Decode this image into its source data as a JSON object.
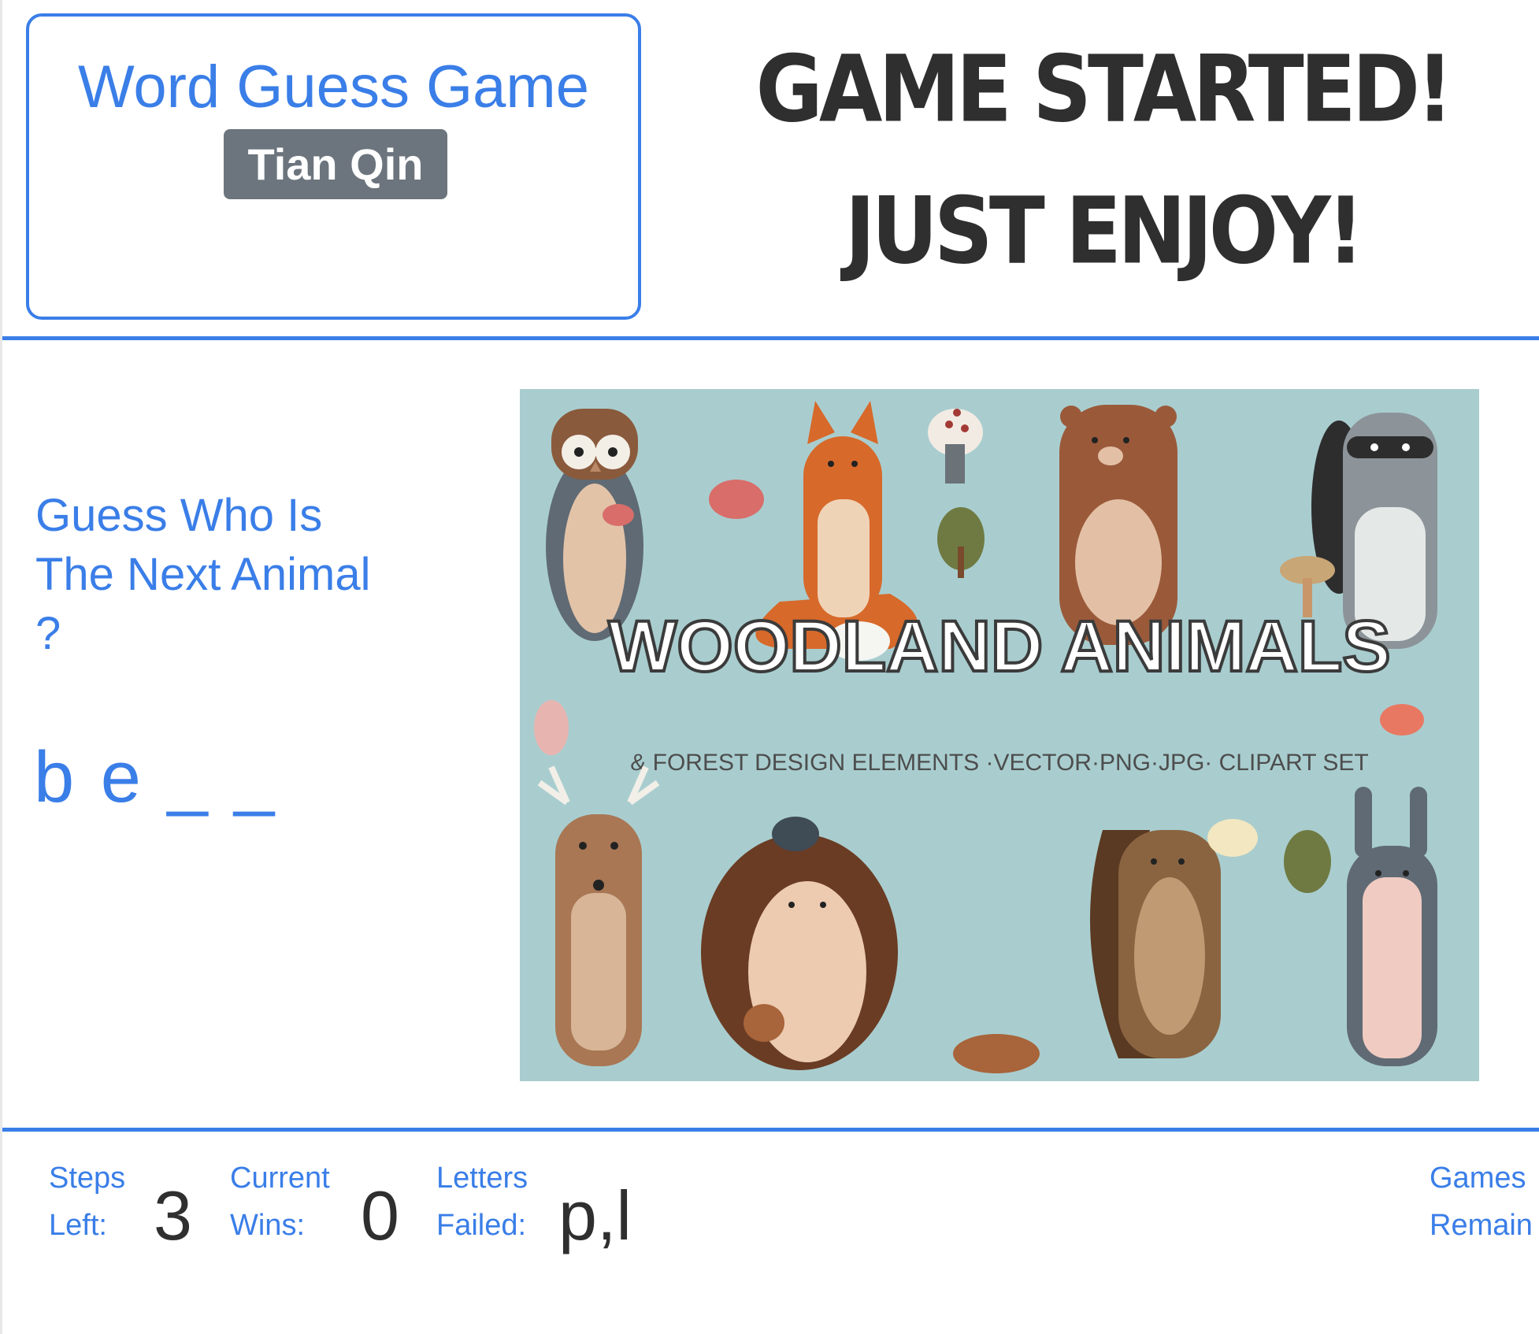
{
  "header": {
    "title": "Word Guess Game",
    "author": "Tian Qin",
    "status_line1": "GAME STARTED!",
    "status_line2": "JUST ENJOY!"
  },
  "game": {
    "prompt": "Guess Who Is The Next Animal ?",
    "word_display": "b e _ _"
  },
  "illustration": {
    "title": "WOODLAND ANIMALS",
    "subtitle": "& FOREST DESIGN ELEMENTS ·VECTOR·PNG·JPG· CLIPART SET",
    "background_color": "#a9cdcf"
  },
  "stats": {
    "steps_left_label_1": "Steps",
    "steps_left_label_2": "Left:",
    "steps_left_value": "3",
    "wins_label_1": "Current",
    "wins_label_2": "Wins:",
    "wins_value": "0",
    "failed_label_1": "Letters",
    "failed_label_2": "Failed:",
    "failed_value": "p,l",
    "games_label_1": "Games",
    "games_label_2": "Remain"
  },
  "colors": {
    "accent": "#3a7ee8",
    "badge": "#6c757d",
    "text": "#2f2f2f"
  }
}
